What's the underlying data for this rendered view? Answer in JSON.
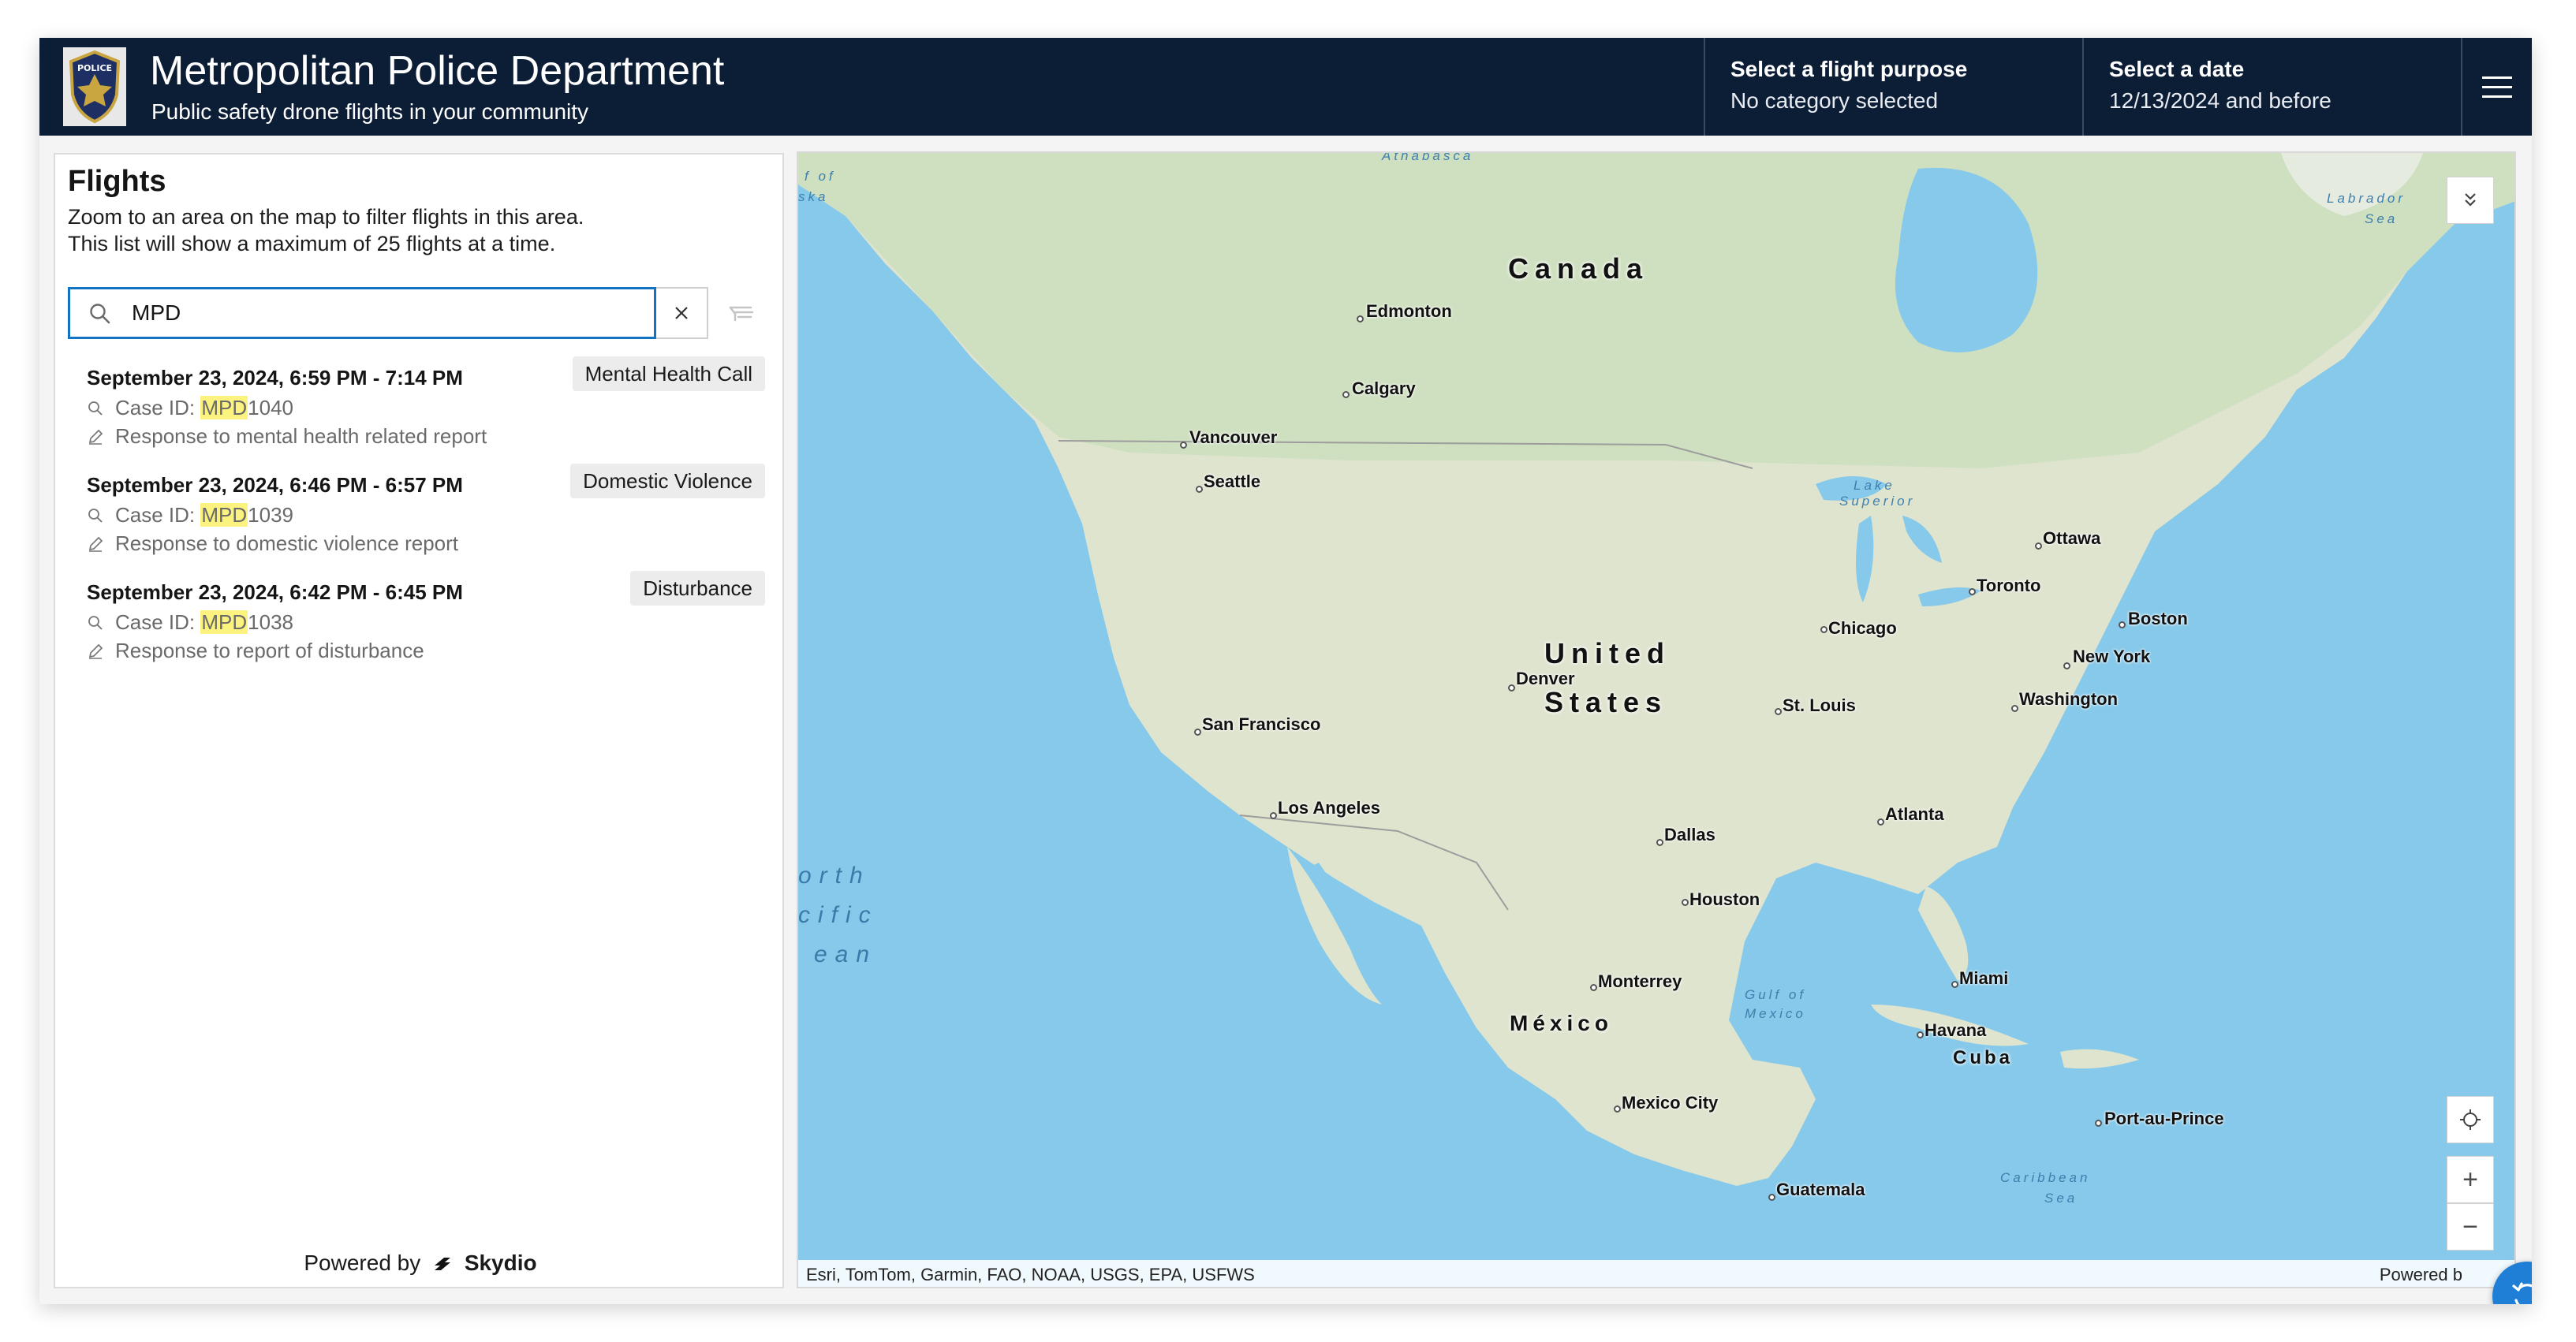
{
  "header": {
    "title": "Metropolitan Police Department",
    "subtitle": "Public safety drone flights in your community",
    "badge_text": "POLICE",
    "purpose_label": "Select a flight purpose",
    "purpose_value": "No category selected",
    "date_label": "Select a date",
    "date_value": "12/13/2024 and before",
    "colors": {
      "header_bg": "#0c1d36",
      "accent": "#1273c4"
    }
  },
  "panel": {
    "title": "Flights",
    "help_line1": "Zoom to an area on the map to filter flights in this area.",
    "help_line2": "This list will show a maximum of 25 flights at a time.",
    "search_value": "MPD",
    "powered_prefix": "Powered by",
    "powered_brand": "Skydio"
  },
  "flights": [
    {
      "when": "September 23, 2024, 6:59 PM - 7:14 PM",
      "category": "Mental Health Call",
      "case_label": "Case ID: ",
      "case_match": "MPD",
      "case_rest": "1040",
      "description": "Response to mental health related report"
    },
    {
      "when": "September 23, 2024, 6:46 PM - 6:57 PM",
      "category": "Domestic Violence",
      "case_label": "Case ID: ",
      "case_match": "MPD",
      "case_rest": "1039",
      "description": "Response to domestic violence report"
    },
    {
      "when": "September 23, 2024, 6:42 PM - 6:45 PM",
      "category": "Disturbance",
      "case_label": "Case ID: ",
      "case_match": "MPD",
      "case_rest": "1038",
      "description": "Response to report of disturbance"
    }
  ],
  "map": {
    "countries": {
      "canada": "Canada",
      "us_line1": "United",
      "us_line2": "States",
      "mexico": "México",
      "cuba": "Cuba"
    },
    "cities": {
      "edmonton": "Edmonton",
      "calgary": "Calgary",
      "vancouver": "Vancouver",
      "seattle": "Seattle",
      "ottawa": "Ottawa",
      "toronto": "Toronto",
      "boston": "Boston",
      "new_york": "New York",
      "chicago": "Chicago",
      "washington": "Washington",
      "denver": "Denver",
      "st_louis": "St. Louis",
      "san_francisco": "San Francisco",
      "los_angeles": "Los Angeles",
      "atlanta": "Atlanta",
      "dallas": "Dallas",
      "houston": "Houston",
      "miami": "Miami",
      "monterrey": "Monterrey",
      "havana": "Havana",
      "mexico_city": "Mexico City",
      "port_au_prince": "Port-au-Prince",
      "guatemala": "Guatemala"
    },
    "water": {
      "athabasca": "Athabasca",
      "lake_superior_1": "Lake",
      "lake_superior_2": "Superior",
      "gulf_1": "Gulf of",
      "gulf_2": "Mexico",
      "caribbean_1": "Caribbean",
      "caribbean_2": "Sea",
      "labrador_1": "Labrador",
      "labrador_2": "Sea",
      "pacific_1": "orth",
      "pacific_2": "cific",
      "pacific_3": "ean",
      "alaska_1": "f of",
      "alaska_2": "ska"
    },
    "zoom_in": "+",
    "zoom_out": "−",
    "attribution": "Esri, TomTom, Garmin, FAO, NOAA, USGS, EPA, USFWS",
    "powered": "Powered b"
  }
}
